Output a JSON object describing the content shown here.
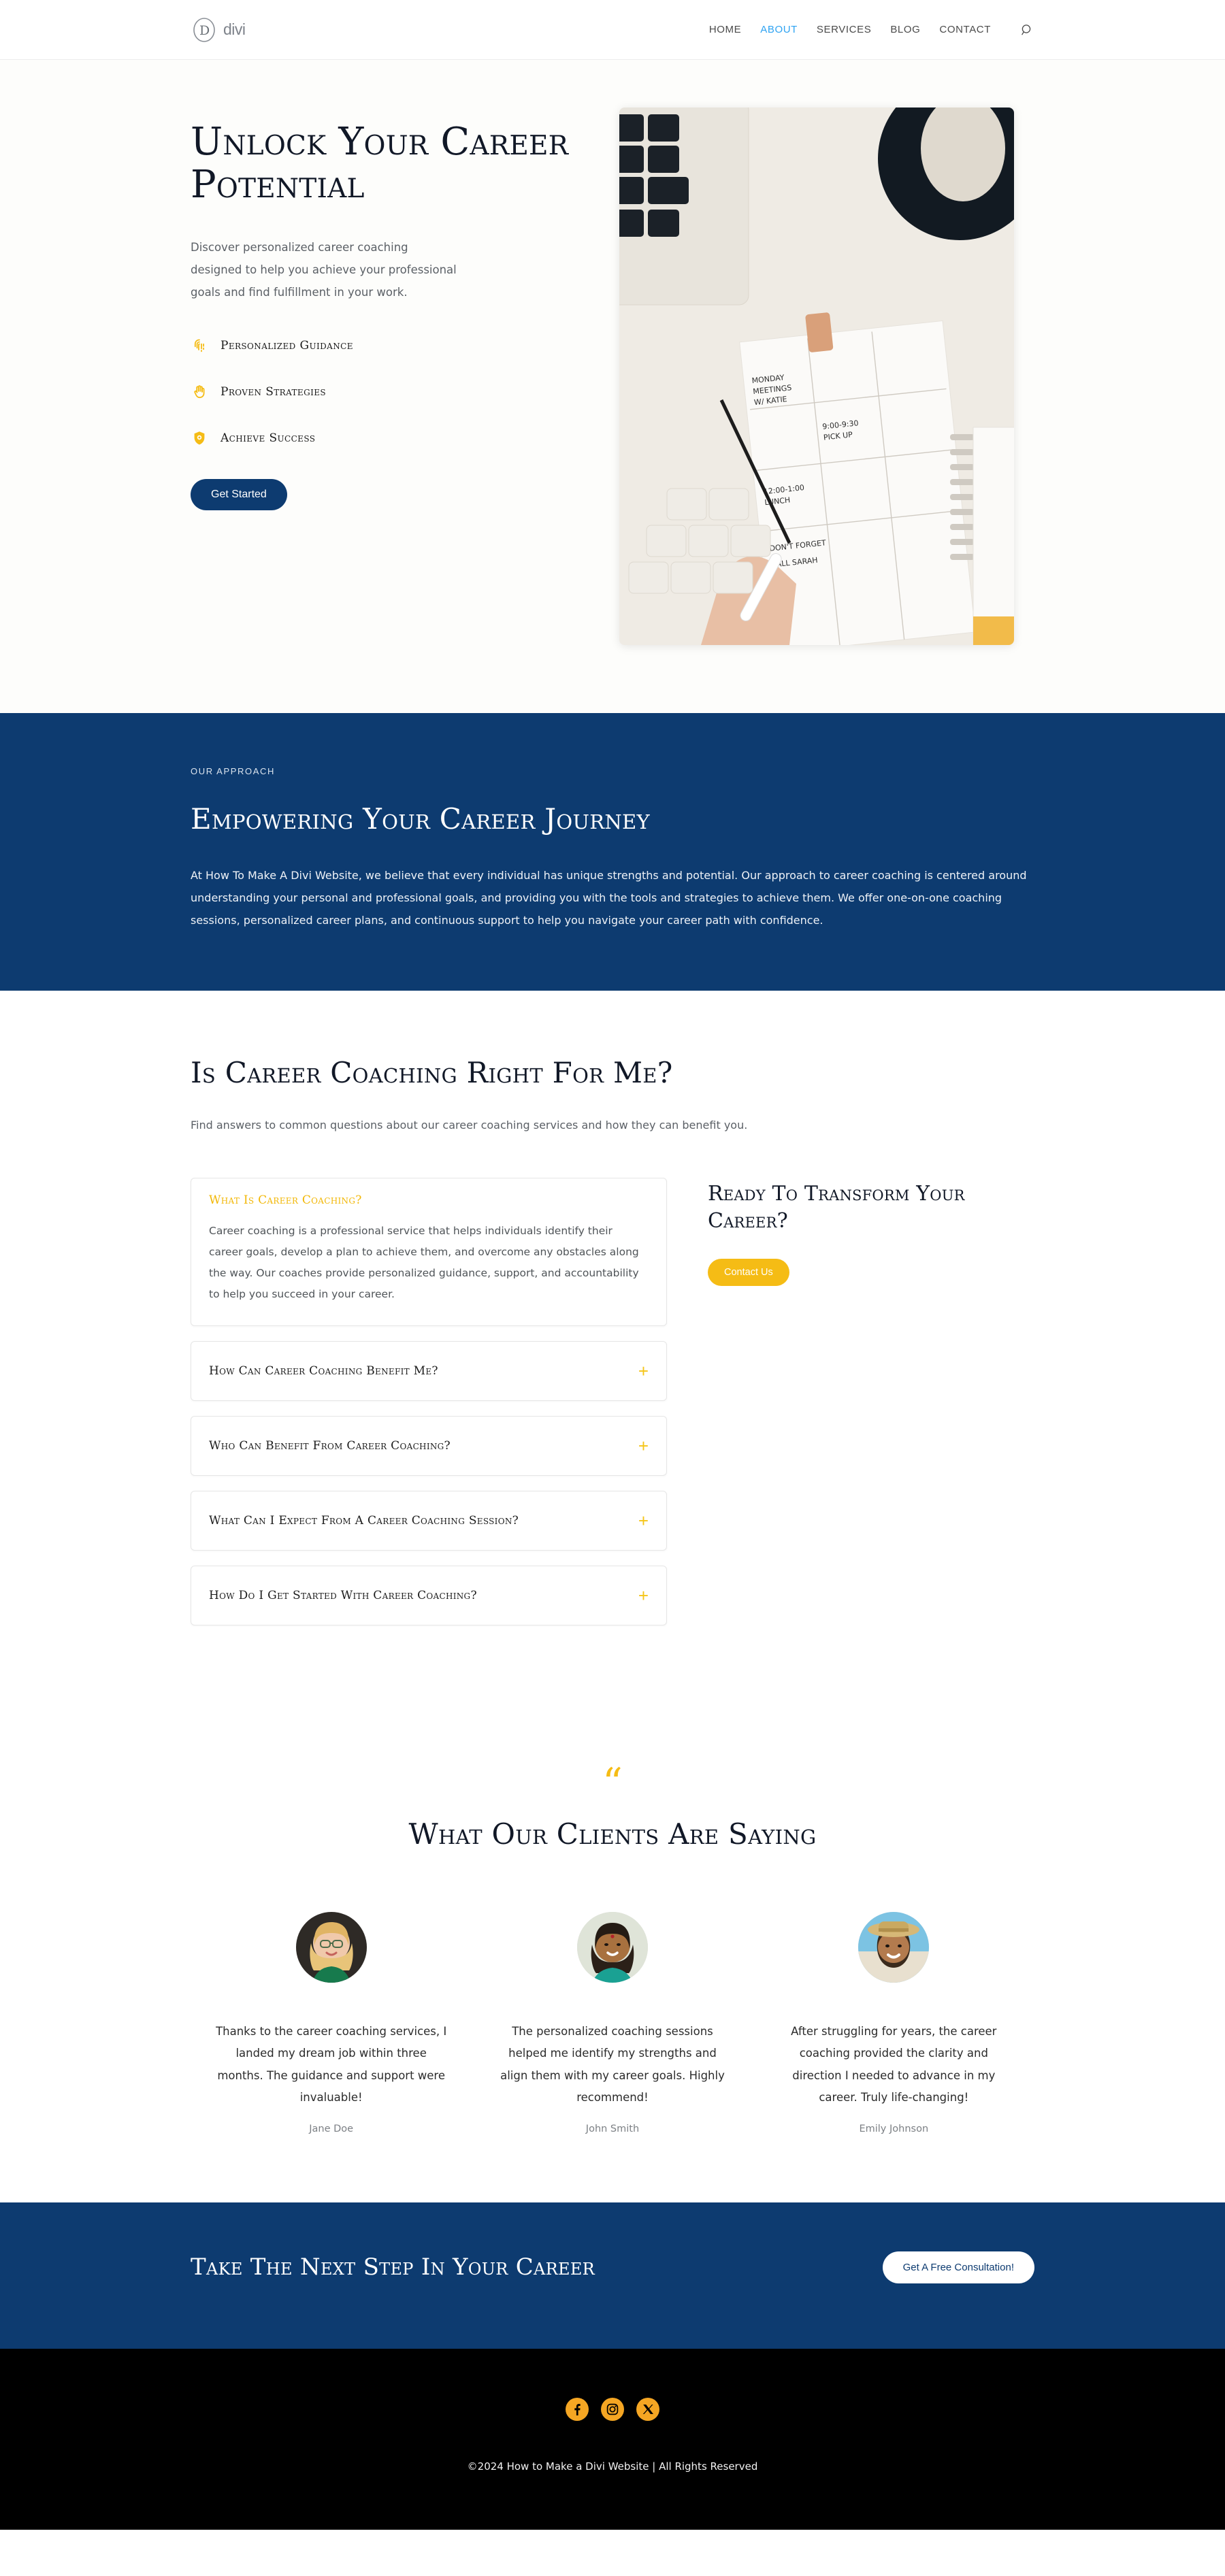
{
  "header": {
    "logo_text": "divi",
    "nav": [
      {
        "label": "HOME",
        "active": false
      },
      {
        "label": "ABOUT",
        "active": true
      },
      {
        "label": "SERVICES",
        "active": false
      },
      {
        "label": "BLOG",
        "active": false
      },
      {
        "label": "CONTACT",
        "active": false
      }
    ],
    "search_icon": "search-icon"
  },
  "hero": {
    "title": "Unlock Your Career Potential",
    "subtitle": "Discover personalized career coaching designed to help you achieve your professional goals and find fulfillment in your work.",
    "features": [
      {
        "icon": "fingerprint-icon",
        "label": "Personalized Guidance"
      },
      {
        "icon": "hand-icon",
        "label": "Proven Strategies"
      },
      {
        "icon": "shield-gear-icon",
        "label": "Achieve Success"
      }
    ],
    "cta_label": "Get Started",
    "image_alt": "desk-planner-photo"
  },
  "approach": {
    "eyebrow": "OUR APPROACH",
    "heading": "Empowering Your Career Journey",
    "body": "At How To Make A Divi Website, we believe that every individual has unique strengths and potential. Our approach to career coaching is centered around understanding your personal and professional goals, and providing you with the tools and strategies to achieve them. We offer one-on-one coaching sessions, personalized career plans, and continuous support to help you navigate your career path with confidence."
  },
  "faq": {
    "heading": "Is Career Coaching Right for Me?",
    "intro": "Find answers to common questions about our career coaching services and how they can benefit you.",
    "items": [
      {
        "question": "What is career coaching?",
        "answer": "Career coaching is a professional service that helps individuals identify their career goals, develop a plan to achieve them, and overcome any obstacles along the way. Our coaches provide personalized guidance, support, and accountability to help you succeed in your career.",
        "open": true,
        "toggle": "+"
      },
      {
        "question": "How can career coaching benefit me?",
        "answer": "",
        "open": false,
        "toggle": "+"
      },
      {
        "question": "Who can benefit from career coaching?",
        "answer": "",
        "open": false,
        "toggle": "+"
      },
      {
        "question": "What can I expect from a career coaching session?",
        "answer": "",
        "open": false,
        "toggle": "+"
      },
      {
        "question": "How do I get started with career coaching?",
        "answer": "",
        "open": false,
        "toggle": "+"
      }
    ],
    "side": {
      "heading": "Ready to Transform Your Career?",
      "cta_label": "Contact Us"
    }
  },
  "testimonials": {
    "quote_glyph": "“",
    "heading": "What Our Clients Are Saying",
    "cards": [
      {
        "avatar": "avatar-jane-doe",
        "quote": "Thanks to the career coaching services, I landed my dream job within three months. The guidance and support were invaluable!",
        "name": "Jane Doe"
      },
      {
        "avatar": "avatar-john-smith",
        "quote": "The personalized coaching sessions helped me identify my strengths and align them with my career goals. Highly recommend!",
        "name": "John Smith"
      },
      {
        "avatar": "avatar-emily-johnson",
        "quote": "After struggling for years, the career coaching provided the clarity and direction I needed to advance in my career. Truly life-changing!",
        "name": "Emily Johnson"
      }
    ]
  },
  "cta": {
    "heading": "Take the Next Step in Your Career",
    "button_label": "Get A Free Consultation!"
  },
  "footer": {
    "socials": [
      {
        "name": "facebook-icon",
        "glyph": "f"
      },
      {
        "name": "instagram-icon",
        "glyph": ""
      },
      {
        "name": "x-twitter-icon",
        "glyph": "X"
      }
    ],
    "copyright": "©2024 How to Make a Divi Website | All Rights Reserved"
  },
  "colors": {
    "brand_blue": "#0d3b70",
    "accent_yellow": "#f5bc15",
    "link_blue": "#2ea3f2",
    "footer_black": "#000000",
    "social_orange": "#f5a623"
  }
}
